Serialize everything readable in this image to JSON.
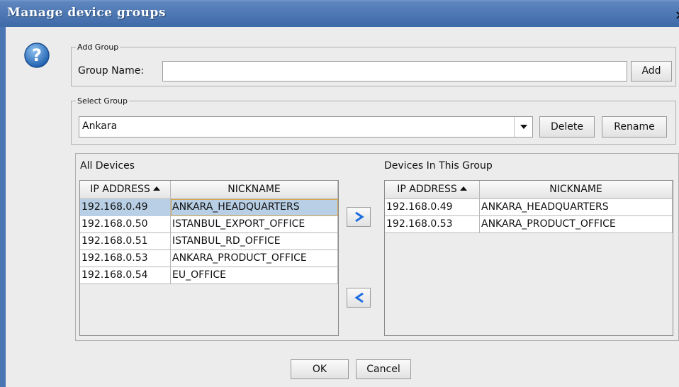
{
  "window": {
    "title": "Manage device groups"
  },
  "add_group": {
    "legend": "Add Group",
    "name_label": "Group Name:",
    "name_value": "",
    "add_label": "Add"
  },
  "select_group": {
    "legend": "Select Group",
    "selected": "Ankara",
    "delete_label": "Delete",
    "rename_label": "Rename"
  },
  "all_devices": {
    "title": "All Devices",
    "columns": [
      "IP ADDRESS",
      "NICKNAME"
    ],
    "rows": [
      [
        "192.168.0.49",
        "ANKARA_HEADQUARTERS"
      ],
      [
        "192.168.0.50",
        "ISTANBUL_EXPORT_OFFICE"
      ],
      [
        "192.168.0.51",
        "ISTANBUL_RD_OFFICE"
      ],
      [
        "192.168.0.53",
        "ANKARA_PRODUCT_OFFICE"
      ],
      [
        "192.168.0.54",
        "EU_OFFICE"
      ]
    ]
  },
  "group_devices": {
    "title": "Devices In This Group",
    "columns": [
      "IP ADDRESS",
      "NICKNAME"
    ],
    "rows": [
      [
        "192.168.0.49",
        "ANKARA_HEADQUARTERS"
      ],
      [
        "192.168.0.53",
        "ANKARA_PRODUCT_OFFICE"
      ]
    ]
  },
  "footer": {
    "ok_label": "OK",
    "cancel_label": "Cancel"
  },
  "icons": {
    "help": "question-mark-icon",
    "close": "close-icon",
    "move_right": "arrow-right-icon",
    "move_left": "arrow-left-icon"
  },
  "colors": {
    "titlebar": "#4a77b4",
    "selection": "#b8cfe5",
    "arrow": "#1f6fe0"
  }
}
